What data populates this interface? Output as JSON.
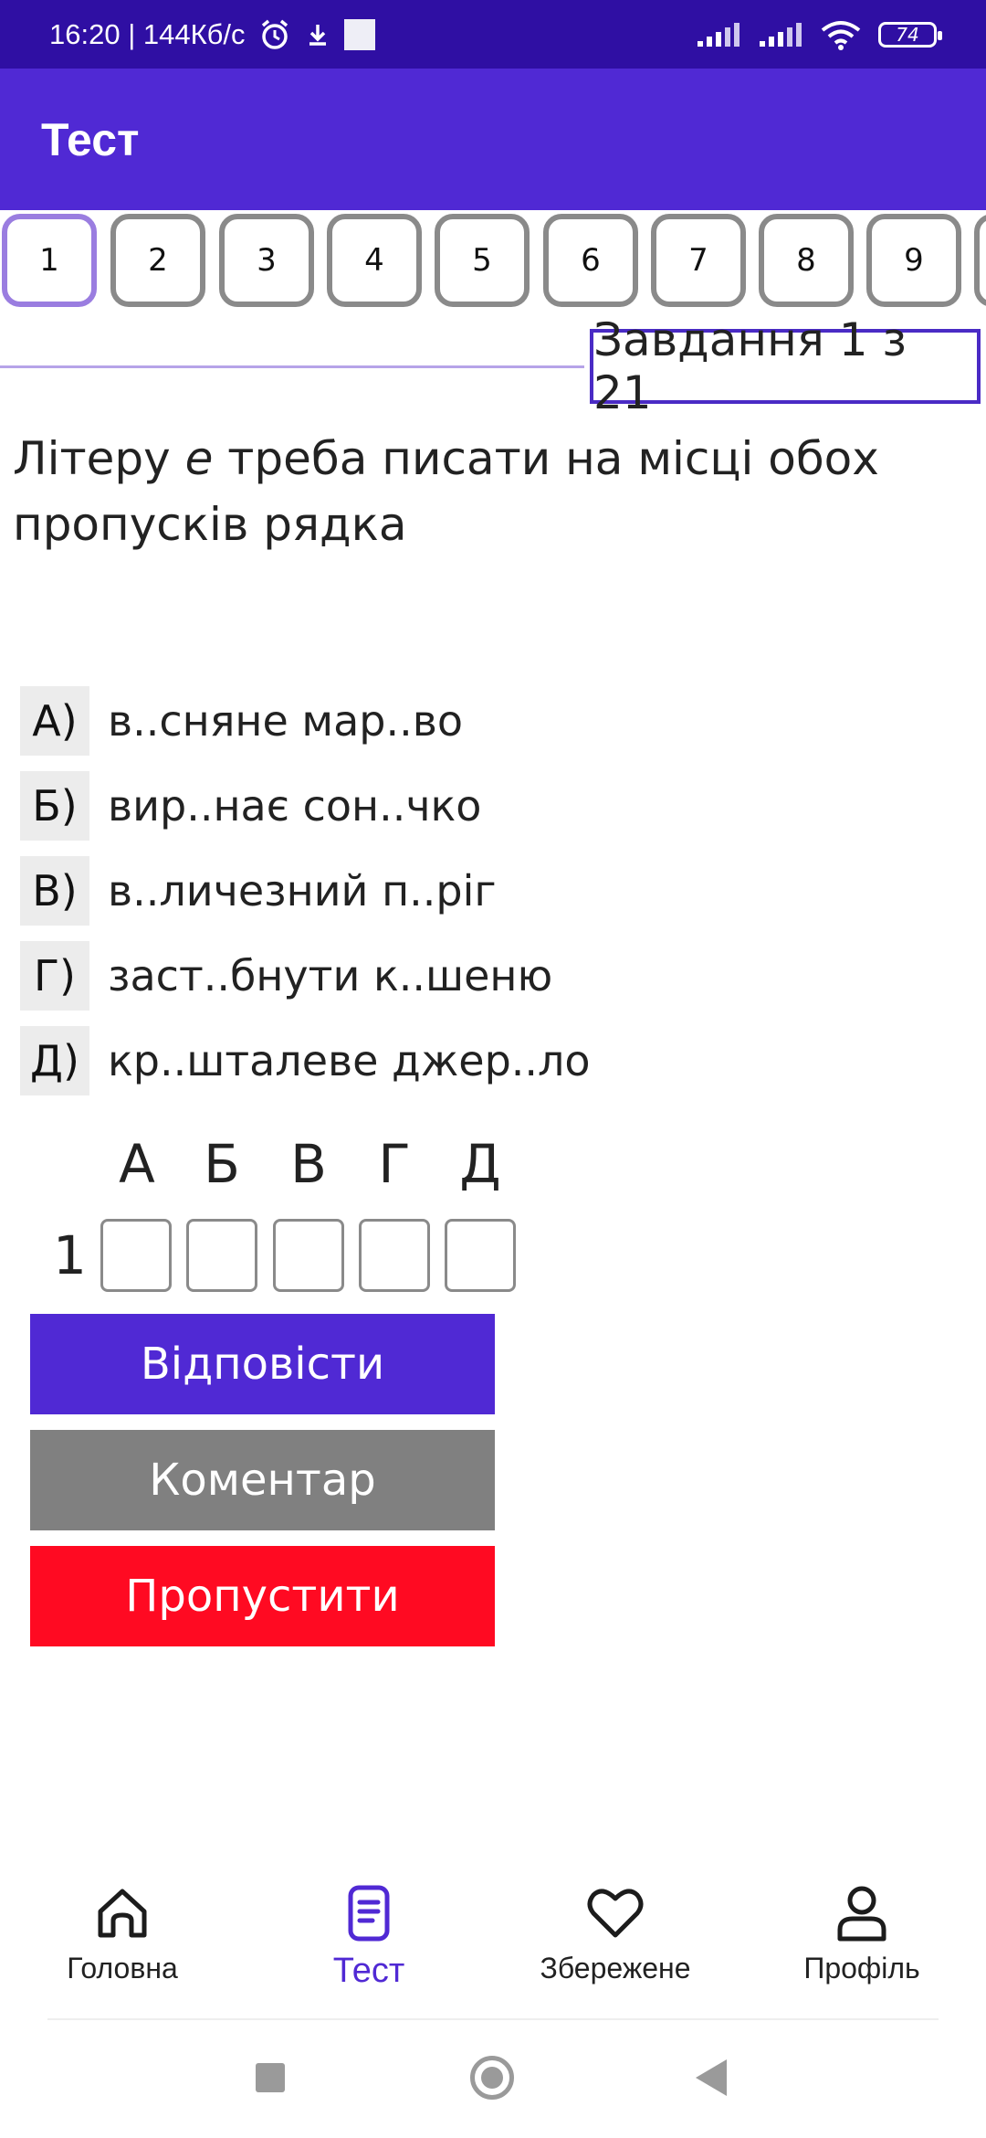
{
  "status_bar": {
    "time_speed": "16:20 | 144Кб/с",
    "battery": "74"
  },
  "app_bar": {
    "title": "Тест"
  },
  "question_numbers": [
    "1",
    "2",
    "3",
    "4",
    "5",
    "6",
    "7",
    "8",
    "9"
  ],
  "task_counter": "Завдання 1 з 21",
  "question": {
    "before": "Літеру ",
    "letter": "е",
    "after": " треба писати на місці обох пропусків рядка"
  },
  "options": [
    {
      "letter": "А)",
      "text": "в..сняне мар..во"
    },
    {
      "letter": "Б)",
      "text": "вир..нає сон..чко"
    },
    {
      "letter": "В)",
      "text": "в..личезний п..ріг"
    },
    {
      "letter": "Г)",
      "text": "заст..бнути к..шеню"
    },
    {
      "letter": "Д)",
      "text": "кр..шталеве джер..ло"
    }
  ],
  "answer_grid": {
    "columns": [
      "А",
      "Б",
      "В",
      "Г",
      "Д"
    ],
    "row_label": "1"
  },
  "buttons": {
    "answer": "Відповісти",
    "comment": "Коментар",
    "skip": "Пропустити"
  },
  "bottom_nav": [
    {
      "label": "Головна",
      "icon": "home-icon"
    },
    {
      "label": "Тест",
      "icon": "document-icon",
      "active": true
    },
    {
      "label": "Збережене",
      "icon": "heart-icon"
    },
    {
      "label": "Профіль",
      "icon": "person-icon"
    }
  ],
  "colors": {
    "status_bar": "#2f0fa3",
    "primary": "#5029d4",
    "comment_button": "#808080",
    "skip_button": "#ff0a22",
    "active_question_border": "#9a7de0"
  }
}
